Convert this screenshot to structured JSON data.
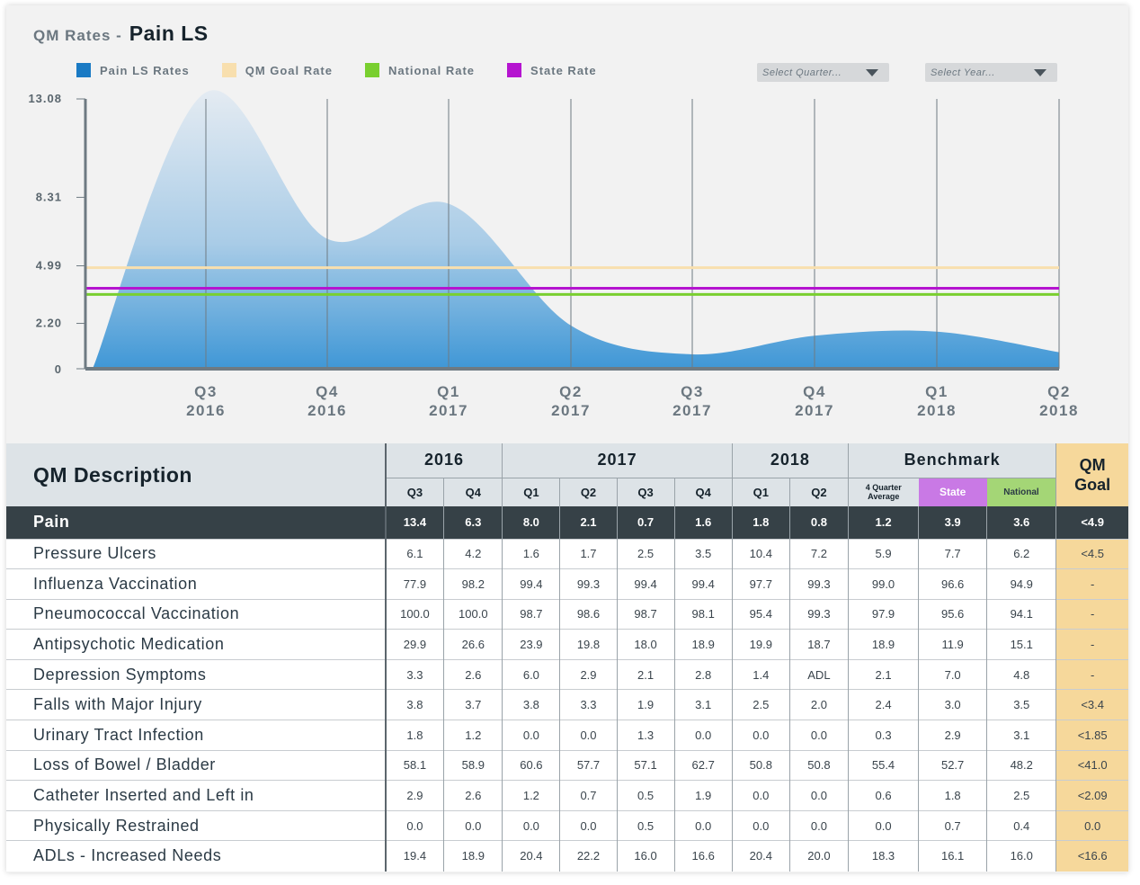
{
  "title": {
    "prefix": "QM  Rates -",
    "main": "Pain LS"
  },
  "legend": [
    {
      "label": "Pain LS Rates",
      "color": "#1a7ac4"
    },
    {
      "label": "QM Goal Rate",
      "color": "#f8dfae"
    },
    {
      "label": "National Rate",
      "color": "#79cf2f"
    },
    {
      "label": "State Rate",
      "color": "#b514d0"
    }
  ],
  "controls": {
    "quarter_placeholder": "Select Quarter...",
    "year_placeholder": "Select Year..."
  },
  "chart_data": {
    "type": "area",
    "x": [
      "Q3 2016",
      "Q4 2016",
      "Q1 2017",
      "Q2 2017",
      "Q3 2017",
      "Q4 2017",
      "Q1 2018",
      "Q2 2018"
    ],
    "x_ticks": [
      {
        "q": "Q3",
        "y": "2016"
      },
      {
        "q": "Q4",
        "y": "2016"
      },
      {
        "q": "Q1",
        "y": "2017"
      },
      {
        "q": "Q2",
        "y": "2017"
      },
      {
        "q": "Q3",
        "y": "2017"
      },
      {
        "q": "Q4",
        "y": "2017"
      },
      {
        "q": "Q1",
        "y": "2018"
      },
      {
        "q": "Q2",
        "y": "2018"
      }
    ],
    "y_ticks": [
      "0",
      "2.20",
      "4.99",
      "8.31",
      "13.08"
    ],
    "ylim": [
      0,
      13.08
    ],
    "series": [
      {
        "name": "Pain LS Rates",
        "values": [
          13.4,
          6.3,
          8.0,
          2.1,
          0.7,
          1.6,
          1.8,
          0.8
        ]
      },
      {
        "name": "QM Goal Rate",
        "values": [
          4.9,
          4.9,
          4.9,
          4.9,
          4.9,
          4.9,
          4.9,
          4.9
        ]
      },
      {
        "name": "National Rate",
        "values": [
          3.6,
          3.6,
          3.6,
          3.6,
          3.6,
          3.6,
          3.6,
          3.6
        ]
      },
      {
        "name": "State Rate",
        "values": [
          3.9,
          3.9,
          3.9,
          3.9,
          3.9,
          3.9,
          3.9,
          3.9
        ]
      }
    ],
    "grid": true
  },
  "table": {
    "desc_header": "QM Description",
    "years": [
      "2016",
      "2017",
      "2018"
    ],
    "benchmark_header": "Benchmark",
    "goal_header_1": "QM",
    "goal_header_2": "Goal",
    "quarters": [
      "Q3",
      "Q4",
      "Q1",
      "Q2",
      "Q3",
      "Q4",
      "Q1",
      "Q2"
    ],
    "bench_cols": {
      "avg_1": "4 Quarter",
      "avg_2": "Average",
      "state": "State",
      "national": "National"
    },
    "rows": [
      {
        "label": "Pain",
        "values": [
          "13.4",
          "6.3",
          "8.0",
          "2.1",
          "0.7",
          "1.6",
          "1.8",
          "0.8"
        ],
        "avg": "1.2",
        "state": "3.9",
        "national": "3.6",
        "goal": "<4.9"
      },
      {
        "label": "Pressure Ulcers",
        "values": [
          "6.1",
          "4.2",
          "1.6",
          "1.7",
          "2.5",
          "3.5",
          "10.4",
          "7.2"
        ],
        "avg": "5.9",
        "state": "7.7",
        "national": "6.2",
        "goal": "<4.5"
      },
      {
        "label": "Influenza Vaccination",
        "values": [
          "77.9",
          "98.2",
          "99.4",
          "99.3",
          "99.4",
          "99.4",
          "97.7",
          "99.3"
        ],
        "avg": "99.0",
        "state": "96.6",
        "national": "94.9",
        "goal": "-"
      },
      {
        "label": "Pneumococcal Vaccination",
        "values": [
          "100.0",
          "100.0",
          "98.7",
          "98.6",
          "98.7",
          "98.1",
          "95.4",
          "99.3"
        ],
        "avg": "97.9",
        "state": "95.6",
        "national": "94.1",
        "goal": "-"
      },
      {
        "label": "Antipsychotic Medication",
        "values": [
          "29.9",
          "26.6",
          "23.9",
          "19.8",
          "18.0",
          "18.9",
          "19.9",
          "18.7"
        ],
        "avg": "18.9",
        "state": "11.9",
        "national": "15.1",
        "goal": "-"
      },
      {
        "label": "Depression Symptoms",
        "values": [
          "3.3",
          "2.6",
          "6.0",
          "2.9",
          "2.1",
          "2.8",
          "1.4",
          "ADL"
        ],
        "avg": "2.1",
        "state": "7.0",
        "national": "4.8",
        "goal": "-"
      },
      {
        "label": "Falls with Major Injury",
        "values": [
          "3.8",
          "3.7",
          "3.8",
          "3.3",
          "1.9",
          "3.1",
          "2.5",
          "2.0"
        ],
        "avg": "2.4",
        "state": "3.0",
        "national": "3.5",
        "goal": "<3.4"
      },
      {
        "label": "Urinary Tract Infection",
        "values": [
          "1.8",
          "1.2",
          "0.0",
          "0.0",
          "1.3",
          "0.0",
          "0.0",
          "0.0"
        ],
        "avg": "0.3",
        "state": "2.9",
        "national": "3.1",
        "goal": "<1.85"
      },
      {
        "label": "Loss of Bowel / Bladder",
        "values": [
          "58.1",
          "58.9",
          "60.6",
          "57.7",
          "57.1",
          "62.7",
          "50.8",
          "50.8"
        ],
        "avg": "55.4",
        "state": "52.7",
        "national": "48.2",
        "goal": "<41.0"
      },
      {
        "label": "Catheter Inserted and Left in",
        "values": [
          "2.9",
          "2.6",
          "1.2",
          "0.7",
          "0.5",
          "1.9",
          "0.0",
          "0.0"
        ],
        "avg": "0.6",
        "state": "1.8",
        "national": "2.5",
        "goal": "<2.09"
      },
      {
        "label": "Physically Restrained",
        "values": [
          "0.0",
          "0.0",
          "0.0",
          "0.0",
          "0.5",
          "0.0",
          "0.0",
          "0.0"
        ],
        "avg": "0.0",
        "state": "0.7",
        "national": "0.4",
        "goal": "0.0"
      },
      {
        "label": "ADLs - Increased Needs",
        "values": [
          "19.4",
          "18.9",
          "20.4",
          "22.2",
          "16.0",
          "16.6",
          "20.4",
          "20.0"
        ],
        "avg": "18.3",
        "state": "16.1",
        "national": "16.0",
        "goal": "<16.6"
      }
    ]
  }
}
